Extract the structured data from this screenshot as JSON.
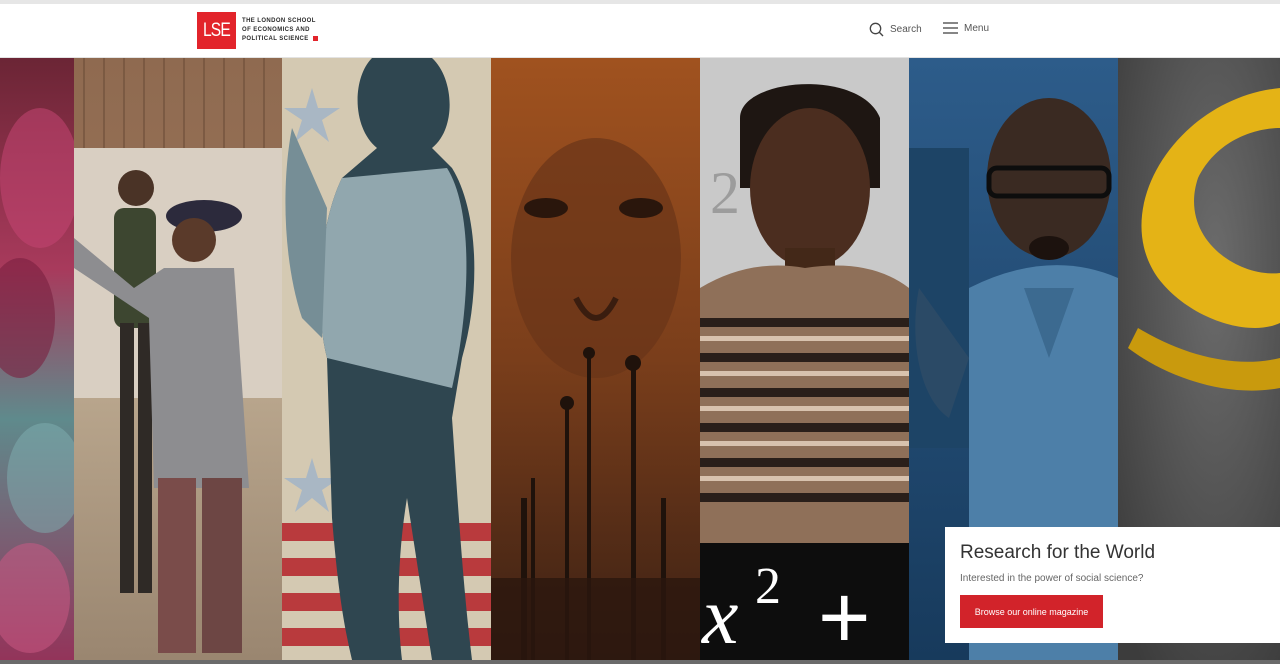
{
  "logo": {
    "mark": "LSE",
    "line1": "The London School",
    "line2": "of Economics and",
    "line3": "Political Science"
  },
  "header": {
    "search_label": "Search",
    "menu_label": "Menu"
  },
  "hero": {
    "panels": [
      {
        "name": "pink-smoke"
      },
      {
        "name": "border-wall-children"
      },
      {
        "name": "illustrated-walker"
      },
      {
        "name": "sepia-portrait"
      },
      {
        "name": "woman-striped-sweater"
      },
      {
        "name": "man-speaking"
      },
      {
        "name": "yellow-ribbon"
      }
    ],
    "math_overlay": {
      "base": "x",
      "exponent": "2",
      "plus": "+",
      "background_digits": "2"
    }
  },
  "card": {
    "title": "Research for the World",
    "subtitle": "Interested in the power of social science?",
    "button_label": "Browse our online magazine"
  },
  "colors": {
    "brand_red": "#e2242b",
    "cta_red": "#d2232a"
  }
}
